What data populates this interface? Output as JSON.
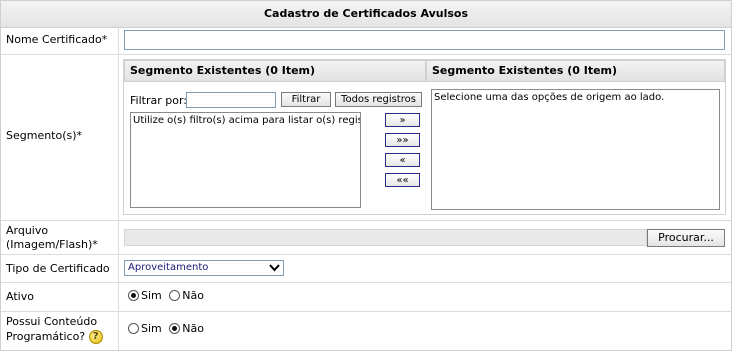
{
  "form": {
    "title": "Cadastro de Certificados Avulsos",
    "nome_label": "Nome Certificado*",
    "nome_value": "",
    "segmento_label": "Segmento(s)*",
    "arquivo_label_line1": "Arquivo",
    "arquivo_label_line2": "(Imagem/Flash)*",
    "tipo_label": "Tipo de Certificado",
    "ativo_label": "Ativo",
    "possui_label_line1": "Possui Conteúdo",
    "possui_label_line2": "Programático?"
  },
  "segmento": {
    "left_header": "Segmento Existentes   (0 Item)",
    "right_header": "Segmento Existentes   (0 Item)",
    "filter_label": "Filtrar por:",
    "filter_value": "",
    "filter_button": "Filtrar",
    "all_button": "Todos registros",
    "left_list_text": "Utilize o(s) filtro(s) acima para listar o(s) registros",
    "right_list_text": "Selecione uma das opções de origem ao lado.",
    "move_buttons": [
      "»",
      "»»",
      "«",
      "««"
    ]
  },
  "arquivo": {
    "browse_button": "Procurar..."
  },
  "tipo": {
    "selected": "Aproveitamento"
  },
  "ativo": {
    "options": [
      "Sim",
      "Não"
    ],
    "selected": "Sim"
  },
  "possui": {
    "options": [
      "Sim",
      "Não"
    ],
    "selected": "Não",
    "help_icon": "help-icon"
  }
}
